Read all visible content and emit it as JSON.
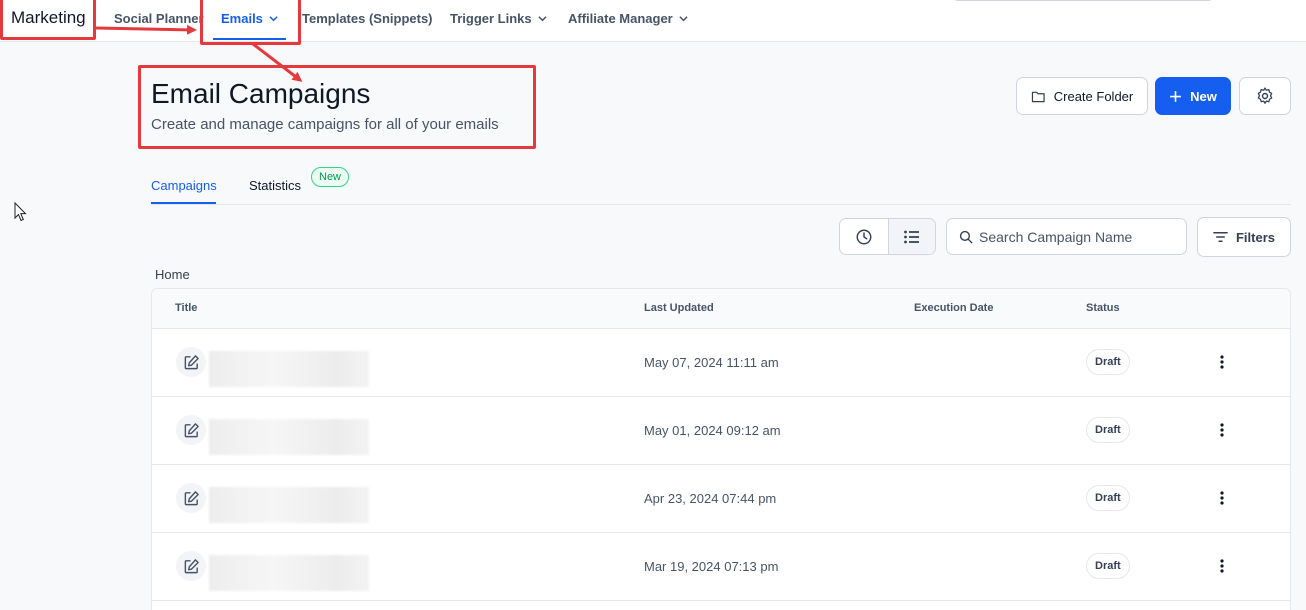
{
  "nav": {
    "brand": "Marketing",
    "items": [
      {
        "label": "Social Planner"
      },
      {
        "label": "Emails"
      },
      {
        "label": "Templates (Snippets)"
      },
      {
        "label": "Trigger Links"
      },
      {
        "label": "Affiliate Manager"
      }
    ]
  },
  "header": {
    "title": "Email Campaigns",
    "subtitle": "Create and manage campaigns for all of your emails",
    "create_folder_label": "Create Folder",
    "new_label": "New"
  },
  "tabs": [
    {
      "label": "Campaigns",
      "active": true
    },
    {
      "label": "Statistics",
      "badge": "New"
    }
  ],
  "toolbar": {
    "search_placeholder": "Search Campaign Name",
    "filters_label": "Filters"
  },
  "breadcrumb": "Home",
  "table": {
    "columns": [
      "Title",
      "Last Updated",
      "Execution Date",
      "Status"
    ],
    "rows": [
      {
        "last_updated": "May 07, 2024 11:11 am",
        "execution_date": "",
        "status": "Draft"
      },
      {
        "last_updated": "May 01, 2024 09:12 am",
        "execution_date": "",
        "status": "Draft"
      },
      {
        "last_updated": "Apr 23, 2024 07:44 pm",
        "execution_date": "",
        "status": "Draft"
      },
      {
        "last_updated": "Mar 19, 2024 07:13 pm",
        "execution_date": "",
        "status": "Draft"
      }
    ]
  },
  "colors": {
    "primary": "#155eef",
    "annotation": "#e5393e",
    "badge_green": "#039855"
  },
  "icons": [
    "chevron-down-icon",
    "folder-icon",
    "plus-icon",
    "gear-icon",
    "clock-icon",
    "list-icon",
    "search-icon",
    "filter-icon",
    "edit-icon",
    "kebab-icon",
    "cursor-icon"
  ]
}
